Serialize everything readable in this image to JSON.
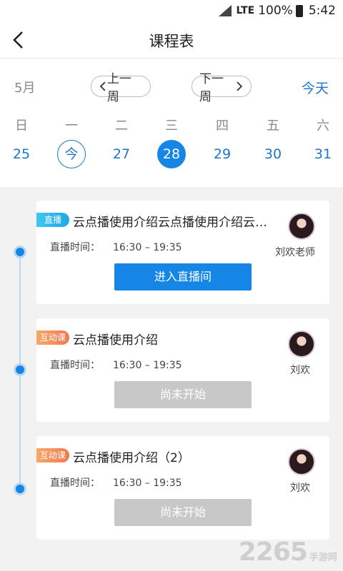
{
  "status_bar": {
    "network": "LTE",
    "battery": "100%",
    "time": "5:42"
  },
  "header": {
    "title": "课程表",
    "back_icon": "chevron-left-icon"
  },
  "week_nav": {
    "month": "5月",
    "prev_label": "上一周",
    "next_label": "下一周",
    "today_label": "今天"
  },
  "days": [
    {
      "name": "日",
      "num": "25",
      "state": "normal"
    },
    {
      "name": "一",
      "num": "今",
      "state": "today"
    },
    {
      "name": "二",
      "num": "27",
      "state": "normal"
    },
    {
      "name": "三",
      "num": "28",
      "state": "selected"
    },
    {
      "name": "四",
      "num": "29",
      "state": "normal"
    },
    {
      "name": "五",
      "num": "30",
      "state": "normal"
    },
    {
      "name": "六",
      "num": "31",
      "state": "normal"
    }
  ],
  "courses": [
    {
      "tag": "直播",
      "tag_type": "live",
      "title": "云点播使用介绍云点播使用介绍云…",
      "time_label": "直播时间：",
      "time": "16:30 – 19:35",
      "teacher": "刘欢老师",
      "button": "进入直播间",
      "button_state": "primary"
    },
    {
      "tag": "互动课",
      "tag_type": "interact",
      "title": "云点播使用介绍",
      "time_label": "直播时间：",
      "time": "16:30 – 19:35",
      "teacher": "刘欢",
      "button": "尚未开始",
      "button_state": "disabled"
    },
    {
      "tag": "互动课",
      "tag_type": "interact",
      "title": "云点播使用介绍（2）",
      "time_label": "直播时间：",
      "time": "16:30 – 19:35",
      "teacher": "刘欢",
      "button": "尚未开始",
      "button_state": "disabled"
    }
  ],
  "watermark": {
    "number": "2265",
    "site": "手游网"
  },
  "colors": {
    "accent": "#1686e6",
    "link": "#1d76c8",
    "disabled": "#c8c8c8",
    "live_tag": "#20a8e8",
    "interact_tag": "#f07850"
  }
}
